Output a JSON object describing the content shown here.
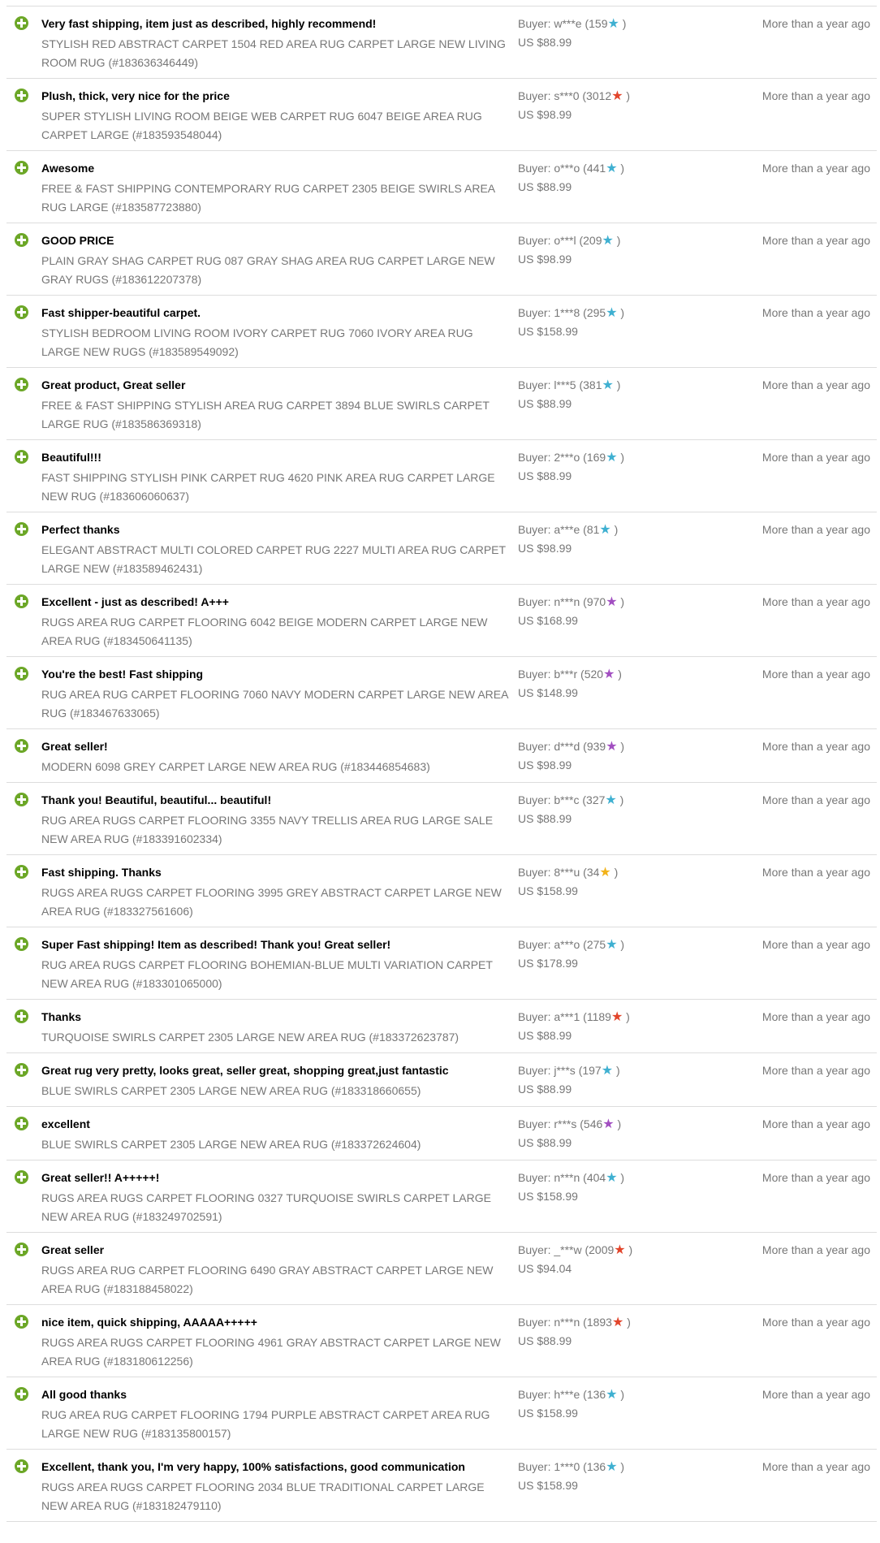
{
  "colors": {
    "positive_icon": "#6ca727",
    "star_teal": "#3fb0d1",
    "star_red": "#e2452b",
    "star_purple": "#a24fc1",
    "star_yellow": "#f2b219"
  },
  "feedback": [
    {
      "comment": "Very fast shipping, item just as described, highly recommend!",
      "item": "STYLISH RED ABSTRACT CARPET 1504 RED AREA RUG CARPET LARGE NEW LIVING ROOM RUG (#183636346449)",
      "buyer_prefix": "Buyer: w***e (159",
      "buyer_suffix": ")",
      "star": "★",
      "star_color": "#3fb0d1",
      "price": "US $88.99",
      "time": "More than a year ago"
    },
    {
      "comment": "Plush, thick, very nice for the price",
      "item": "SUPER STYLISH LIVING ROOM BEIGE WEB CARPET RUG 6047 BEIGE AREA RUG CARPET LARGE (#183593548044)",
      "buyer_prefix": "Buyer: s***0 (3012",
      "buyer_suffix": ")",
      "star": "★",
      "star_color": "#e2452b",
      "price": "US $98.99",
      "time": "More than a year ago"
    },
    {
      "comment": "Awesome",
      "item": "FREE & FAST SHIPPING CONTEMPORARY RUG CARPET 2305 BEIGE SWIRLS AREA RUG LARGE (#183587723880)",
      "buyer_prefix": "Buyer: o***o (441",
      "buyer_suffix": ")",
      "star": "★",
      "star_color": "#3fb0d1",
      "price": "US $88.99",
      "time": "More than a year ago"
    },
    {
      "comment": "GOOD PRICE",
      "item": "PLAIN GRAY SHAG CARPET RUG 087 GRAY SHAG AREA RUG CARPET LARGE NEW GRAY RUGS (#183612207378)",
      "buyer_prefix": "Buyer: o***l (209",
      "buyer_suffix": ")",
      "star": "★",
      "star_color": "#3fb0d1",
      "price": "US $98.99",
      "time": "More than a year ago"
    },
    {
      "comment": "Fast shipper-beautiful carpet.",
      "item": "STYLISH BEDROOM LIVING ROOM IVORY CARPET RUG 7060 IVORY AREA RUG LARGE NEW RUGS (#183589549092)",
      "buyer_prefix": "Buyer: 1***8 (295",
      "buyer_suffix": ")",
      "star": "★",
      "star_color": "#3fb0d1",
      "price": "US $158.99",
      "time": "More than a year ago"
    },
    {
      "comment": "Great product, Great seller",
      "item": "FREE & FAST SHIPPING STYLISH AREA RUG CARPET 3894 BLUE SWIRLS CARPET LARGE RUG (#183586369318)",
      "buyer_prefix": "Buyer: l***5 (381",
      "buyer_suffix": ")",
      "star": "★",
      "star_color": "#3fb0d1",
      "price": "US $88.99",
      "time": "More than a year ago"
    },
    {
      "comment": "Beautiful!!!",
      "item": "FAST SHIPPING STYLISH PINK CARPET RUG 4620 PINK AREA RUG CARPET LARGE NEW RUG (#183606060637)",
      "buyer_prefix": "Buyer: 2***o (169",
      "buyer_suffix": ")",
      "star": "★",
      "star_color": "#3fb0d1",
      "price": "US $88.99",
      "time": "More than a year ago"
    },
    {
      "comment": "Perfect thanks",
      "item": "ELEGANT ABSTRACT MULTI COLORED CARPET RUG 2227 MULTI AREA RUG CARPET LARGE NEW (#183589462431)",
      "buyer_prefix": "Buyer: a***e (81",
      "buyer_suffix": ")",
      "star": "★",
      "star_color": "#3fb0d1",
      "price": "US $98.99",
      "time": "More than a year ago"
    },
    {
      "comment": "Excellent - just as described! A+++",
      "item": "RUGS AREA RUG CARPET FLOORING 6042 BEIGE MODERN CARPET LARGE NEW AREA RUG (#183450641135)",
      "buyer_prefix": "Buyer: n***n (970",
      "buyer_suffix": ")",
      "star": "★",
      "star_color": "#a24fc1",
      "price": "US $168.99",
      "time": "More than a year ago"
    },
    {
      "comment": "You're the best! Fast shipping",
      "item": "RUG AREA RUG CARPET FLOORING 7060 NAVY MODERN CARPET LARGE NEW AREA RUG (#183467633065)",
      "buyer_prefix": "Buyer: b***r (520",
      "buyer_suffix": ")",
      "star": "★",
      "star_color": "#a24fc1",
      "price": "US $148.99",
      "time": "More than a year ago"
    },
    {
      "comment": "Great seller!",
      "item": "MODERN 6098 GREY CARPET LARGE NEW AREA RUG (#183446854683)",
      "buyer_prefix": "Buyer: d***d (939",
      "buyer_suffix": ")",
      "star": "★",
      "star_color": "#a24fc1",
      "price": "US $98.99",
      "time": "More than a year ago"
    },
    {
      "comment": "Thank you! Beautiful, beautiful... beautiful!",
      "item": "RUG AREA RUGS CARPET FLOORING 3355 NAVY TRELLIS AREA RUG LARGE SALE NEW AREA RUG (#183391602334)",
      "buyer_prefix": "Buyer: b***c (327",
      "buyer_suffix": ")",
      "star": "★",
      "star_color": "#3fb0d1",
      "price": "US $88.99",
      "time": "More than a year ago"
    },
    {
      "comment": "Fast shipping. Thanks",
      "item": "RUGS AREA RUGS CARPET FLOORING 3995 GREY ABSTRACT CARPET LARGE NEW AREA RUG (#183327561606)",
      "buyer_prefix": "Buyer: 8***u (34",
      "buyer_suffix": ")",
      "star": "★",
      "star_color": "#f2b219",
      "price": "US $158.99",
      "time": "More than a year ago"
    },
    {
      "comment": "Super Fast shipping! Item as described! Thank you! Great seller!",
      "item": "RUG AREA RUGS CARPET FLOORING BOHEMIAN-BLUE MULTI VARIATION CARPET NEW AREA RUG (#183301065000)",
      "buyer_prefix": "Buyer: a***o (275",
      "buyer_suffix": ")",
      "star": "★",
      "star_color": "#3fb0d1",
      "price": "US $178.99",
      "time": "More than a year ago"
    },
    {
      "comment": "Thanks",
      "item": "TURQUOISE SWIRLS CARPET 2305 LARGE NEW AREA RUG (#183372623787)",
      "buyer_prefix": "Buyer: a***1 (1189",
      "buyer_suffix": ")",
      "star": "★",
      "star_color": "#e2452b",
      "price": "US $88.99",
      "time": "More than a year ago"
    },
    {
      "comment": "Great rug very pretty, looks great, seller great, shopping great,just fantastic",
      "item": "BLUE SWIRLS CARPET 2305 LARGE NEW AREA RUG (#183318660655)",
      "buyer_prefix": "Buyer: j***s (197",
      "buyer_suffix": ")",
      "star": "★",
      "star_color": "#3fb0d1",
      "price": "US $88.99",
      "time": "More than a year ago"
    },
    {
      "comment": "excellent",
      "item": "BLUE SWIRLS CARPET 2305 LARGE NEW AREA RUG (#183372624604)",
      "buyer_prefix": "Buyer: r***s (546",
      "buyer_suffix": ")",
      "star": "★",
      "star_color": "#a24fc1",
      "price": "US $88.99",
      "time": "More than a year ago"
    },
    {
      "comment": "Great seller!! A+++++!",
      "item": "RUGS AREA RUGS CARPET FLOORING 0327 TURQUOISE SWIRLS CARPET LARGE NEW AREA RUG (#183249702591)",
      "buyer_prefix": "Buyer: n***n (404",
      "buyer_suffix": ")",
      "star": "★",
      "star_color": "#3fb0d1",
      "price": "US $158.99",
      "time": "More than a year ago"
    },
    {
      "comment": "Great seller",
      "item": "RUGS AREA RUG CARPET FLOORING 6490 GRAY ABSTRACT CARPET LARGE NEW AREA RUG (#183188458022)",
      "buyer_prefix": "Buyer: _***w (2009",
      "buyer_suffix": ")",
      "star": "★",
      "star_color": "#e2452b",
      "price": "US $94.04",
      "time": "More than a year ago"
    },
    {
      "comment": "nice item, quick shipping, AAAAA+++++",
      "item": "RUGS AREA RUGS CARPET FLOORING 4961 GRAY ABSTRACT CARPET LARGE NEW AREA RUG (#183180612256)",
      "buyer_prefix": "Buyer: n***n (1893",
      "buyer_suffix": ")",
      "star": "★",
      "star_color": "#e2452b",
      "price": "US $88.99",
      "time": "More than a year ago"
    },
    {
      "comment": "All good thanks",
      "item": "RUG AREA RUG CARPET FLOORING 1794 PURPLE ABSTRACT CARPET AREA RUG LARGE NEW RUG (#183135800157)",
      "buyer_prefix": "Buyer: h***e (136",
      "buyer_suffix": ")",
      "star": "★",
      "star_color": "#3fb0d1",
      "price": "US $158.99",
      "time": "More than a year ago"
    },
    {
      "comment": "Excellent, thank you, I'm very happy, 100% satisfactions, good communication",
      "item": "RUGS AREA RUGS CARPET FLOORING 2034 BLUE TRADITIONAL CARPET LARGE NEW AREA RUG (#183182479110)",
      "buyer_prefix": "Buyer: 1***0 (136",
      "buyer_suffix": ")",
      "star": "★",
      "star_color": "#3fb0d1",
      "price": "US $158.99",
      "time": "More than a year ago"
    }
  ]
}
